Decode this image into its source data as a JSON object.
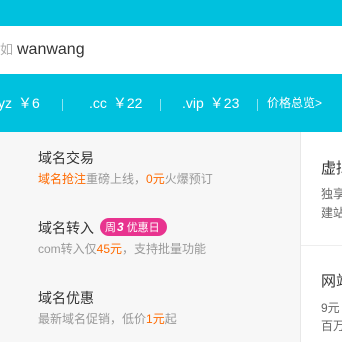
{
  "search": {
    "prefix": "如",
    "value": "wanwang"
  },
  "prices": [
    {
      "tld": "yz",
      "price": "￥6"
    },
    {
      "tld": ".cc",
      "price": "￥22"
    },
    {
      "tld": ".vip",
      "price": "￥23"
    }
  ],
  "price_overview": "价格总览>",
  "menu": {
    "trade": {
      "title": "域名交易",
      "desc_hl1": "域名抢注",
      "desc_mid": "重磅上线，",
      "desc_hl2": "0元",
      "desc_end": "火爆预订"
    },
    "transfer": {
      "title": "域名转入",
      "badge_pre": "周",
      "badge_num": "3",
      "badge_post": "优惠日",
      "desc_pre": "com转入仅",
      "desc_hl": "45元",
      "desc_end": "，支持批量功能"
    },
    "promo": {
      "title": "域名优惠",
      "desc_pre": "最新域名促销，低价",
      "desc_hl": "1元",
      "desc_end": "起"
    }
  },
  "right_panel": {
    "block1": {
      "title": "虚拟",
      "line1": "独享",
      "line2": "建站"
    },
    "block2": {
      "title": "网站",
      "line1": "9元",
      "line2": "百万"
    }
  },
  "colors": {
    "brand": "#00c1de",
    "highlight": "#ff6a00",
    "badge": "#e8338f"
  }
}
